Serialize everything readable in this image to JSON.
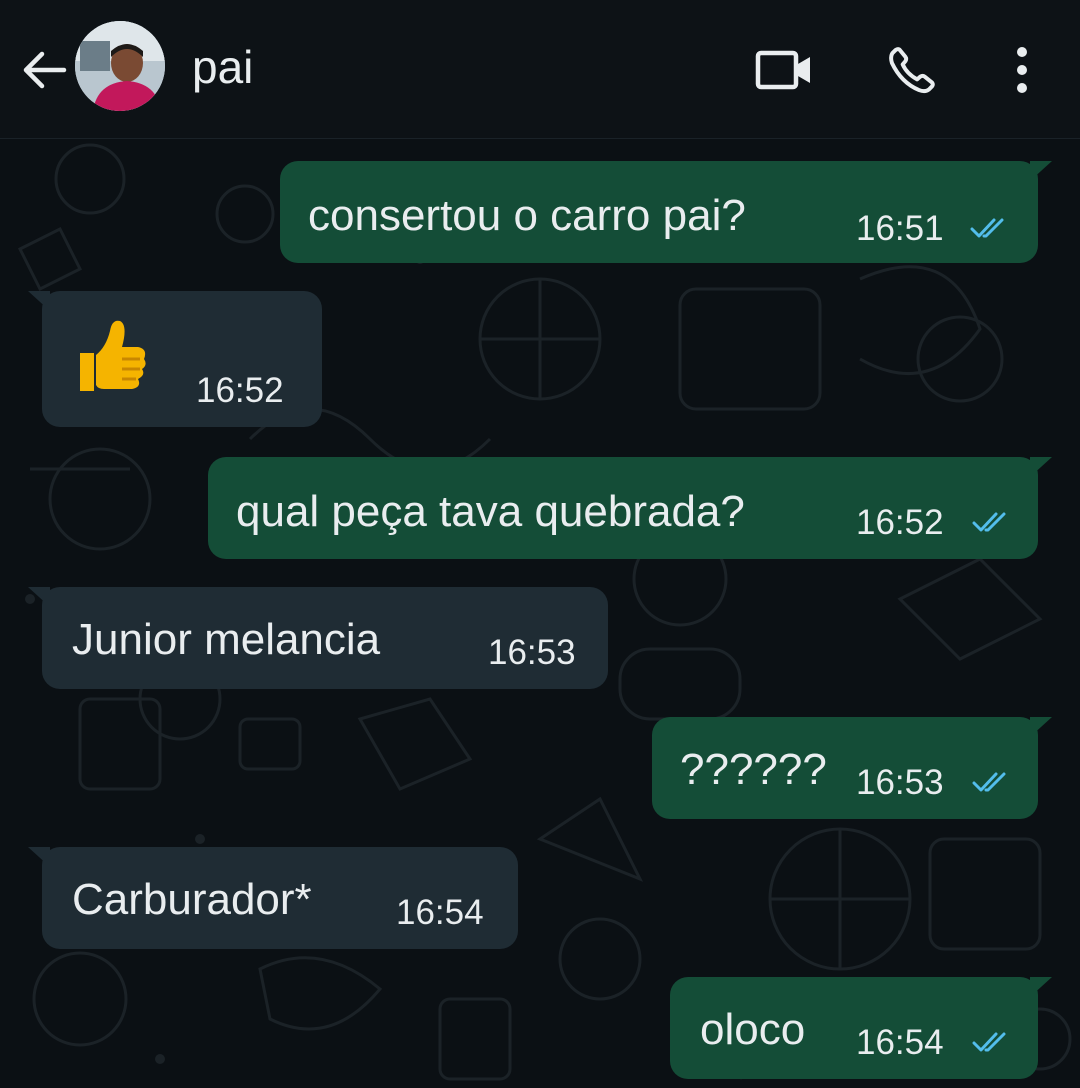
{
  "header": {
    "contact_name": "pai",
    "icons": {
      "back": "arrow-left-icon",
      "video": "video-camera-icon",
      "call": "phone-icon",
      "menu": "more-vertical-icon"
    }
  },
  "colors": {
    "header_bg": "#0d1216",
    "chat_bg": "#0b1014",
    "outgoing_bubble": "#144d37",
    "incoming_bubble": "#1f2c34",
    "text": "#e9edef",
    "read_ticks": "#53bdeb"
  },
  "messages": [
    {
      "direction": "outgoing",
      "text": "consertou o carro pai?",
      "time": "16:51",
      "status": "read"
    },
    {
      "direction": "incoming",
      "text": "👍",
      "time": "16:52"
    },
    {
      "direction": "outgoing",
      "text": "qual peça tava quebrada?",
      "time": "16:52",
      "status": "read"
    },
    {
      "direction": "incoming",
      "text": "Junior melancia",
      "time": "16:53"
    },
    {
      "direction": "outgoing",
      "text": "??????",
      "time": "16:53",
      "status": "read"
    },
    {
      "direction": "incoming",
      "text": "Carburador*",
      "time": "16:54"
    },
    {
      "direction": "outgoing",
      "text": "oloco",
      "time": "16:54",
      "status": "read"
    }
  ]
}
